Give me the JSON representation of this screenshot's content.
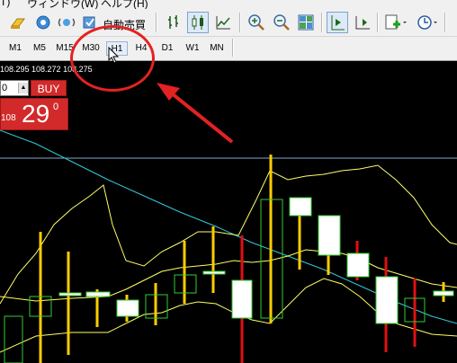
{
  "menu": {
    "items": [
      "(T)",
      "ウィンドウ(W)",
      "ヘルプ(H)"
    ]
  },
  "toolbar": {
    "auto_trading_label": "自動売買",
    "buttons": [
      {
        "name": "experts-icon"
      },
      {
        "name": "navigator-icon"
      },
      {
        "name": "signal-icon"
      },
      {
        "name": "auto-trading-icon"
      },
      {
        "name": "bar-chart-icon"
      },
      {
        "name": "candlestick-icon"
      },
      {
        "name": "line-chart-icon"
      },
      {
        "name": "zoom-in-icon"
      },
      {
        "name": "zoom-out-icon"
      },
      {
        "name": "tile-windows-icon"
      },
      {
        "name": "chart-shift-icon"
      },
      {
        "name": "autoscroll-icon"
      },
      {
        "name": "indicators-icon"
      },
      {
        "name": "periods-icon"
      }
    ]
  },
  "timeframes": {
    "items": [
      "M1",
      "M5",
      "M15",
      "M30",
      "H1",
      "H4",
      "D1",
      "W1",
      "MN"
    ],
    "selected": "H1"
  },
  "quote": {
    "text": "108.295 108.272 108.275"
  },
  "one_click": {
    "lot_value": "0",
    "buy_label": "BUY",
    "price_small": "108",
    "price_big": "29",
    "price_sup": "0"
  },
  "colors": {
    "bull_candle": "#ffffff",
    "bull_body_border": "#33cc33",
    "bear_candle": "#e01010",
    "wick_up": "#ffcc00",
    "bollinger": "#ffff66",
    "ma_line": "#33c8d8",
    "price_line": "#7fa8c8",
    "annotation": "#e32222"
  },
  "chart_data": {
    "type": "candlestick",
    "candles": [
      {
        "o": 0,
        "h": 0,
        "l": 0,
        "c": 0
      }
    ],
    "indicators": [
      "bollinger-bands",
      "moving-average"
    ]
  }
}
